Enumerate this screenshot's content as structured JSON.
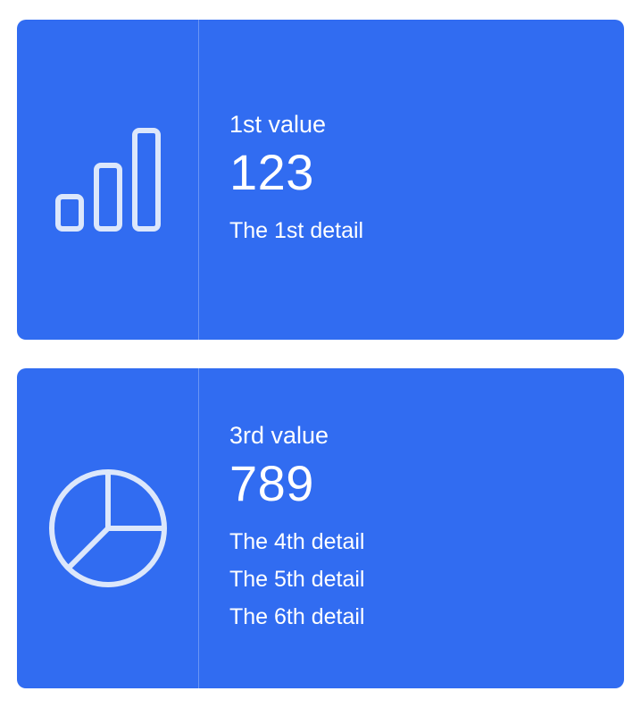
{
  "colors": {
    "card_background": "#316cf1",
    "text": "#ffffff",
    "icon_stroke": "#dce7fb"
  },
  "cards": [
    {
      "icon": "bar-chart-icon",
      "label": "1st value",
      "value": "123",
      "details": [
        "The 1st detail"
      ]
    },
    {
      "icon": "pie-chart-icon",
      "label": "3rd value",
      "value": "789",
      "details": [
        "The 4th detail",
        "The 5th detail",
        "The 6th detail"
      ]
    }
  ]
}
